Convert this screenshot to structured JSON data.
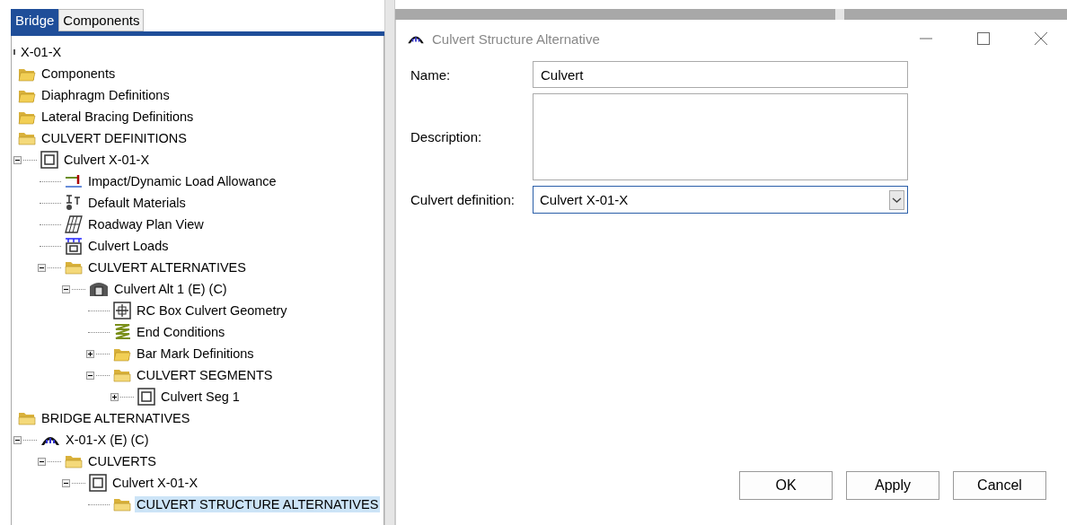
{
  "tabs": [
    {
      "label": "Bridge",
      "selected": true
    },
    {
      "label": "Components",
      "selected": false
    }
  ],
  "tree": [
    {
      "label": "X-01-X",
      "kind": "root",
      "selected": false,
      "children": [
        {
          "label": "Components",
          "kind": "folder",
          "selected": false
        },
        {
          "label": "Diaphragm Definitions",
          "kind": "folder",
          "selected": false
        },
        {
          "label": "Lateral Bracing Definitions",
          "kind": "folder",
          "selected": false
        },
        {
          "label": "CULVERT DEFINITIONS",
          "kind": "open-folder",
          "selected": false,
          "children": [
            {
              "label": "Culvert X-01-X",
              "kind": "box",
              "expanded": true,
              "selected": false,
              "children": [
                {
                  "label": "Impact/Dynamic Load Allowance",
                  "kind": "impact",
                  "selected": false
                },
                {
                  "label": "Default Materials",
                  "kind": "materials",
                  "selected": false
                },
                {
                  "label": "Roadway Plan View",
                  "kind": "plan",
                  "selected": false
                },
                {
                  "label": "Culvert Loads",
                  "kind": "loads",
                  "selected": false
                },
                {
                  "label": "CULVERT ALTERNATIVES",
                  "kind": "open-folder",
                  "expanded": true,
                  "selected": false,
                  "children": [
                    {
                      "label": "Culvert Alt 1 (E)  (C)",
                      "kind": "alternative",
                      "expanded": true,
                      "selected": false,
                      "children": [
                        {
                          "label": "RC Box Culvert Geometry",
                          "kind": "geometry",
                          "selected": false
                        },
                        {
                          "label": "End Conditions",
                          "kind": "ends",
                          "selected": false
                        },
                        {
                          "label": "Bar Mark Definitions",
                          "kind": "folder",
                          "expanded": false,
                          "selected": false
                        },
                        {
                          "label": "CULVERT SEGMENTS",
                          "kind": "open-folder",
                          "expanded": true,
                          "selected": false,
                          "children": [
                            {
                              "label": "Culvert Seg 1",
                              "kind": "box",
                              "expanded": false,
                              "selected": false
                            }
                          ]
                        }
                      ]
                    }
                  ]
                }
              ]
            }
          ]
        },
        {
          "label": "BRIDGE ALTERNATIVES",
          "kind": "open-folder",
          "selected": false,
          "children": [
            {
              "label": "X-01-X (E)  (C)",
              "kind": "bridge",
              "expanded": true,
              "selected": false,
              "children": [
                {
                  "label": "CULVERTS",
                  "kind": "open-folder",
                  "expanded": true,
                  "selected": false,
                  "children": [
                    {
                      "label": "Culvert X-01-X",
                      "kind": "box",
                      "expanded": true,
                      "selected": false,
                      "children": [
                        {
                          "label": "CULVERT STRUCTURE ALTERNATIVES",
                          "kind": "open-folder",
                          "selected": true
                        }
                      ]
                    }
                  ]
                }
              ]
            }
          ]
        }
      ]
    }
  ],
  "dialog": {
    "title": "Culvert Structure Alternative",
    "name_label": "Name:",
    "name_value": "Culvert",
    "description_label": "Description:",
    "definition_label": "Culvert definition:",
    "definition_value": "Culvert X-01-X",
    "buttons": [
      "OK",
      "Apply",
      "Cancel"
    ]
  }
}
